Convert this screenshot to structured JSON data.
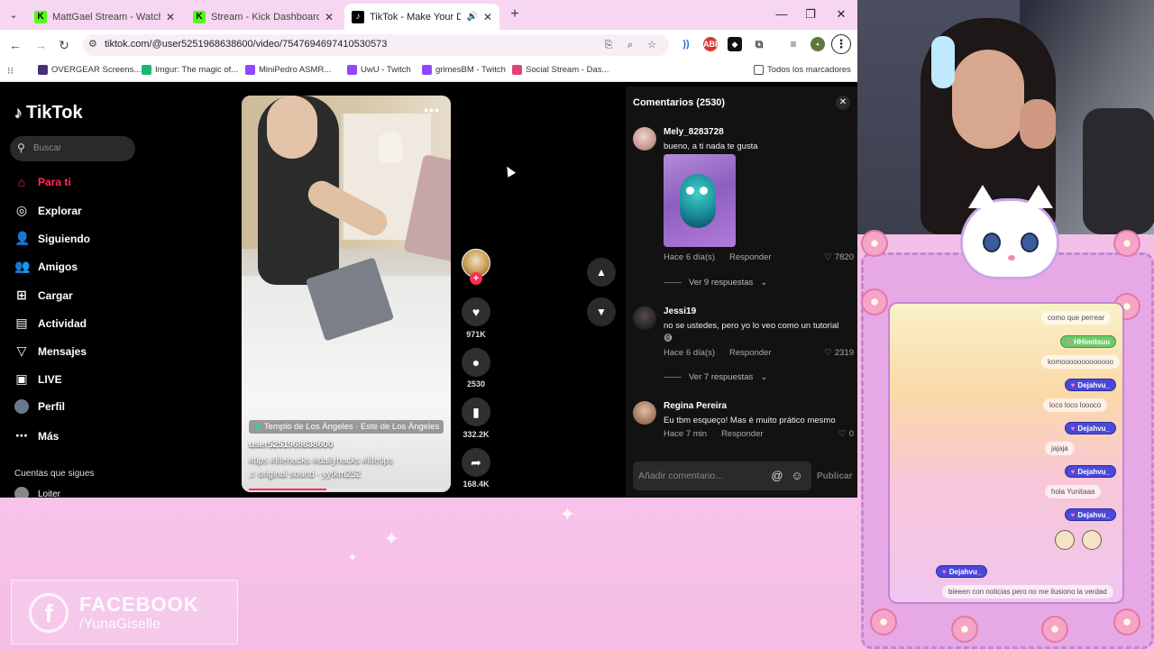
{
  "browser": {
    "tabs": [
      {
        "title": "MattGael Stream - Watch Live",
        "favicon": "kick-logo",
        "active": false
      },
      {
        "title": "Stream - Kick Dashboard",
        "favicon": "kick-logo",
        "active": false
      },
      {
        "title": "TikTok - Make Your Day",
        "favicon": "tiktok-logo",
        "active": true,
        "audio": true
      }
    ],
    "url": "tiktok.com/@user5251968638600/video/7547694697410530573",
    "bookmarks": [
      {
        "label": "OVERGEAR Screens..."
      },
      {
        "label": "Imgur: The magic of..."
      },
      {
        "label": "MiniPedro ASMR..."
      },
      {
        "label": "UwU - Twitch"
      },
      {
        "label": "grimesBM - Twitch"
      },
      {
        "label": "Social Stream - Das..."
      },
      {
        "label": "Todos los marcadores"
      }
    ]
  },
  "tiktok": {
    "logo": "TikTok",
    "search_placeholder": "Buscar",
    "menu": [
      {
        "label": "Para ti",
        "icon": "home-icon",
        "active": true
      },
      {
        "label": "Explorar",
        "icon": "compass-icon",
        "active": false
      },
      {
        "label": "Siguiendo",
        "icon": "following-icon",
        "active": false
      },
      {
        "label": "Amigos",
        "icon": "friends-icon",
        "active": false
      },
      {
        "label": "Cargar",
        "icon": "upload-icon",
        "active": false
      },
      {
        "label": "Actividad",
        "icon": "activity-icon",
        "active": false
      },
      {
        "label": "Mensajes",
        "icon": "messages-icon",
        "active": false
      },
      {
        "label": "LIVE",
        "icon": "live-icon",
        "active": false
      },
      {
        "label": "Perfil",
        "icon": "profile-icon",
        "active": false
      },
      {
        "label": "Más",
        "icon": "more-icon",
        "active": false
      }
    ],
    "following_title": "Cuentas que sigues",
    "following_first": "Loiter",
    "video": {
      "location": "Templo de Los Ángeles · Este de Los Ángeles",
      "username": "user5251968638600",
      "hashtags": "#tips  #lifehacks  #dailyhacks  #lifetips",
      "sound": "original sound - yytkm252",
      "progress": 0.4
    },
    "actions": {
      "likes": "971K",
      "comments": "2530",
      "saves": "332.2K",
      "shares": "168.4K"
    },
    "comments_panel": {
      "title": "Comentarios (2530)",
      "items": [
        {
          "name": "Mely_8283728",
          "text": "bueno, a ti nada te gusta",
          "time": "Hace 6 día(s)",
          "reply": "Responder",
          "likes": "7820",
          "replies": "Ver 9 respuestas",
          "has_sticker": true
        },
        {
          "name": "Jessi19",
          "text": "no se ustedes, pero yo lo veo como un tutorial 😅",
          "time": "Hace 6 día(s)",
          "reply": "Responder",
          "likes": "2319",
          "replies": "Ver 7 respuestas"
        },
        {
          "name": "Regina Pereira",
          "text": "Eu tbm esqueço! Mas é muito prático mesmo",
          "time": "Hace 7 min",
          "reply": "Responder",
          "likes": "0"
        }
      ],
      "input_placeholder": "Añadir comentario...",
      "publish": "Publicar"
    }
  },
  "chat_overlay": {
    "messages": [
      {
        "user": "",
        "text": "como que perrear"
      },
      {
        "user": "HHimitsuu",
        "text": "komooooooooooooo"
      },
      {
        "user": "Dejahvu_",
        "text": "loco loco loooco"
      },
      {
        "user": "Dejahvu_",
        "text": "jajaja"
      },
      {
        "user": "Dejahvu_",
        "text": "hola Yunitaaa"
      },
      {
        "user": "Dejahvu_",
        "text": ""
      },
      {
        "user": "Dejahvu_",
        "text": "bieeen con noticias pero no me ilusiono la verdad"
      }
    ]
  },
  "social": {
    "network": "FACEBOOK",
    "handle": "/YunaGiselle"
  },
  "colors": {
    "tiktok_accent": "#fe2c55",
    "overlay_pink": "#f4bfe6",
    "chat_badge_blue": "#4b49d9"
  }
}
